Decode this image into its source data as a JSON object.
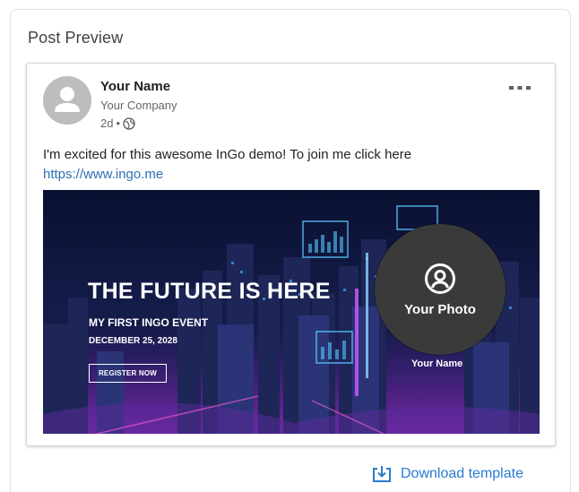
{
  "panel": {
    "title": "Post Preview"
  },
  "post": {
    "author_name": "Your Name",
    "company": "Your Company",
    "age": "2d",
    "separator": "•",
    "text": "I'm excited for this awesome InGo demo! To join me click here",
    "link": "https://www.ingo.me"
  },
  "banner": {
    "headline": "THE FUTURE IS HERE",
    "event": "MY FIRST INGO EVENT",
    "date": "DECEMBER 25, 2028",
    "register_label": "REGISTER NOW",
    "photo_label": "Your Photo",
    "name_label": "Your Name"
  },
  "actions": {
    "download_label": "Download template"
  },
  "colors": {
    "link": "#2f6fb3",
    "download": "#2a7bd1",
    "avatar": "#bdbdbd",
    "photo_circle": "#3a3a3a"
  },
  "icons": [
    "person-icon",
    "globe-icon",
    "more-options-icon",
    "user-circle-icon",
    "download-icon"
  ]
}
